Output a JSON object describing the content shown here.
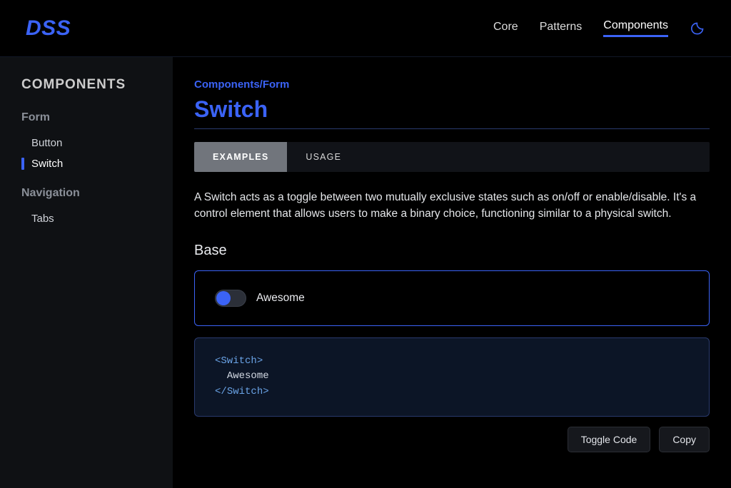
{
  "header": {
    "logo": "DSS",
    "nav": [
      {
        "label": "Core",
        "active": false
      },
      {
        "label": "Patterns",
        "active": false
      },
      {
        "label": "Components",
        "active": true
      }
    ]
  },
  "sidebar": {
    "heading": "COMPONENTS",
    "groups": [
      {
        "title": "Form",
        "items": [
          {
            "label": "Button",
            "active": false
          },
          {
            "label": "Switch",
            "active": true
          }
        ]
      },
      {
        "title": "Navigation",
        "items": [
          {
            "label": "Tabs",
            "active": false
          }
        ]
      }
    ]
  },
  "main": {
    "breadcrumb": "Components/Form",
    "title": "Switch",
    "tabs": [
      {
        "label": "EXAMPLES",
        "active": true
      },
      {
        "label": "USAGE",
        "active": false
      }
    ],
    "description": "A Switch acts as a toggle between two mutually exclusive states such as on/off or enable/disable. It's a control element that allows users to make a binary choice, functioning similar to a physical switch.",
    "section": "Base",
    "demo": {
      "switch_label": "Awesome",
      "switch_on": false
    },
    "code": {
      "open_tag": "Switch",
      "inner_text": "Awesome",
      "close_tag": "Switch"
    },
    "actions": {
      "toggle_code": "Toggle Code",
      "copy": "Copy"
    }
  }
}
